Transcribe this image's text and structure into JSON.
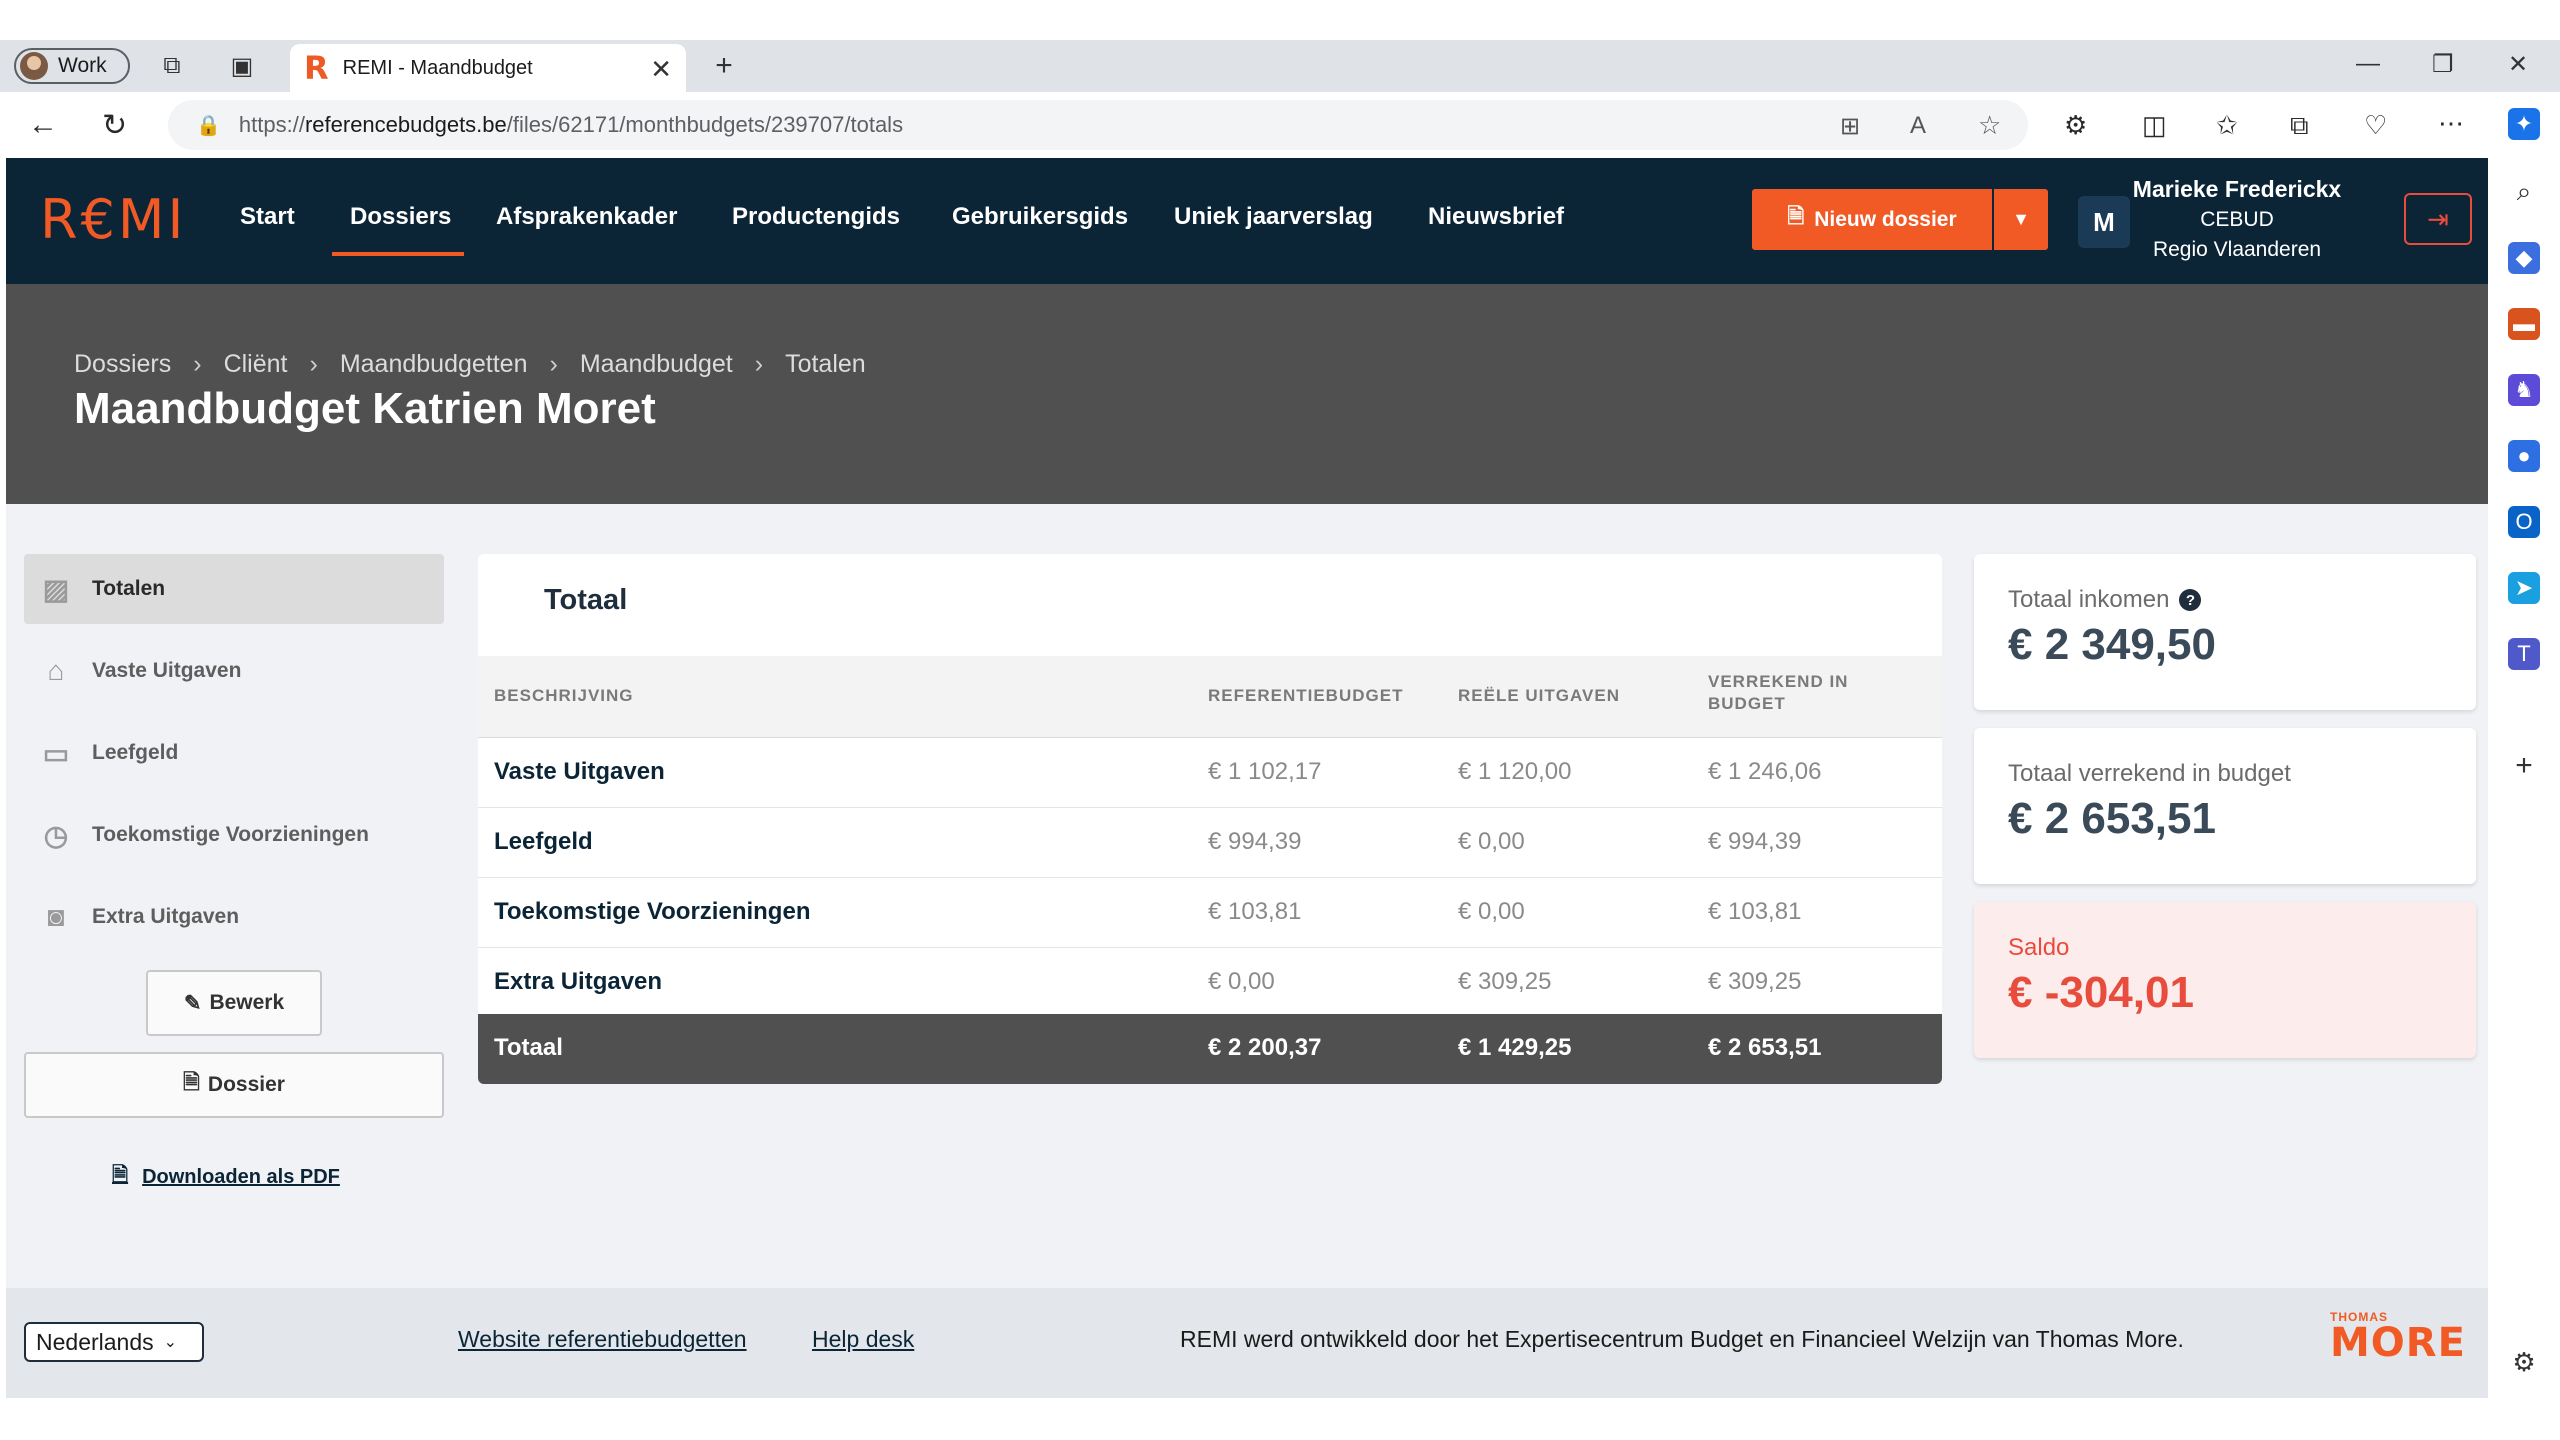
{
  "browser": {
    "profile_label": "Work",
    "tab_title": "REMI - Maandbudget",
    "url_prefix": "https://",
    "url_domain": "referencebudgets.be",
    "url_path": "/files/62171/monthbudgets/239707/totals"
  },
  "site": {
    "logo": "R€MI",
    "nav": [
      "Start",
      "Dossiers",
      "Afsprakenkader",
      "Productengids",
      "Gebruikersgids",
      "Uniek jaarverslag",
      "Nieuwsbrief"
    ],
    "new_button": "Nieuw dossier",
    "user": {
      "initial": "M",
      "name": "Marieke Frederickx",
      "org": "CEBUD",
      "region": "Regio Vlaanderen"
    }
  },
  "breadcrumb": [
    "Dossiers",
    "Cliënt",
    "Maandbudgetten",
    "Maandbudget",
    "Totalen"
  ],
  "page_title": "Maandbudget Katrien Moret",
  "sidebar": {
    "items": [
      {
        "label": "Totalen",
        "icon": "percent-icon"
      },
      {
        "label": "Vaste Uitgaven",
        "icon": "home-icon"
      },
      {
        "label": "Leefgeld",
        "icon": "card-icon"
      },
      {
        "label": "Toekomstige Voorzieningen",
        "icon": "clock-icon"
      },
      {
        "label": "Extra Uitgaven",
        "icon": "bag-icon"
      }
    ],
    "edit_button": "Bewerk",
    "dossier_button": "Dossier",
    "pdf_link": "Downloaden als PDF"
  },
  "table": {
    "title": "Totaal",
    "headers": [
      "BESCHRIJVING",
      "REFERENTIEBUDGET",
      "REËLE UITGAVEN",
      "VERREKEND IN",
      "BUDGET"
    ],
    "rows": [
      {
        "desc": "Vaste Uitgaven",
        "ref": "€ 1 102,17",
        "reel": "€ 1 120,00",
        "verr": "€ 1 246,06"
      },
      {
        "desc": "Leefgeld",
        "ref": "€ 994,39",
        "reel": "€ 0,00",
        "verr": "€ 994,39"
      },
      {
        "desc": "Toekomstige Voorzieningen",
        "ref": "€ 103,81",
        "reel": "€ 0,00",
        "verr": "€ 103,81"
      },
      {
        "desc": "Extra Uitgaven",
        "ref": "€ 0,00",
        "reel": "€ 309,25",
        "verr": "€ 309,25"
      }
    ],
    "total": {
      "label": "Totaal",
      "ref": "€ 2 200,37",
      "reel": "€ 1 429,25",
      "verr": "€ 2 653,51"
    }
  },
  "stats": [
    {
      "label": "Totaal inkomen",
      "value": "€ 2 349,50"
    },
    {
      "label": "Totaal verrekend in budget",
      "value": "€ 2 653,51"
    },
    {
      "label": "Saldo",
      "value": "€ -304,01"
    }
  ],
  "footer": {
    "language": "Nederlands",
    "link1": "Website referentiebudgetten",
    "link2": "Help desk",
    "text": "REMI werd ontwikkeld door het Expertisecentrum Budget en Financieel Welzijn van Thomas More.",
    "logo_small": "THOMAS",
    "logo_big": "MORE"
  },
  "colors": {
    "brand": "#f15a24",
    "navy": "#0b2537",
    "negative": "#e74c3c"
  }
}
